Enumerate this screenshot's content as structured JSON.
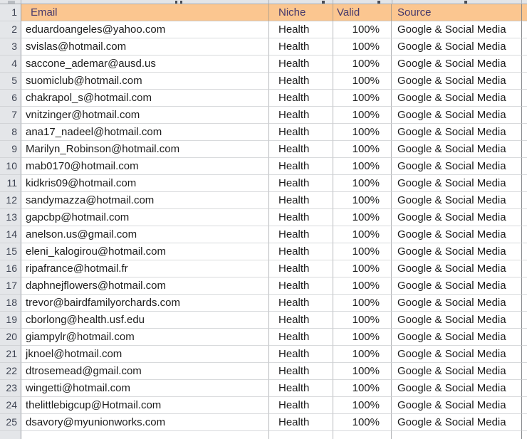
{
  "spreadsheet": {
    "header": {
      "row_number": "1",
      "email": "Email",
      "niche": "Niche",
      "valid": "Valid",
      "source": "Source"
    },
    "rows": [
      {
        "n": "2",
        "email": "eduardoangeles@yahoo.com",
        "niche": "Health",
        "valid": "100%",
        "source": "Google & Social Media"
      },
      {
        "n": "3",
        "email": "svislas@hotmail.com",
        "niche": "Health",
        "valid": "100%",
        "source": "Google & Social Media"
      },
      {
        "n": "4",
        "email": "saccone_ademar@ausd.us",
        "niche": "Health",
        "valid": "100%",
        "source": "Google & Social Media"
      },
      {
        "n": "5",
        "email": "suomiclub@hotmail.com",
        "niche": "Health",
        "valid": "100%",
        "source": "Google & Social Media"
      },
      {
        "n": "6",
        "email": "chakrapol_s@hotmail.com",
        "niche": "Health",
        "valid": "100%",
        "source": "Google & Social Media"
      },
      {
        "n": "7",
        "email": "vnitzinger@hotmail.com",
        "niche": "Health",
        "valid": "100%",
        "source": "Google & Social Media"
      },
      {
        "n": "8",
        "email": "ana17_nadeel@hotmail.com",
        "niche": "Health",
        "valid": "100%",
        "source": "Google & Social Media"
      },
      {
        "n": "9",
        "email": "Marilyn_Robinson@hotmail.com",
        "niche": "Health",
        "valid": "100%",
        "source": "Google & Social Media"
      },
      {
        "n": "10",
        "email": "mab0170@hotmail.com",
        "niche": "Health",
        "valid": "100%",
        "source": "Google & Social Media"
      },
      {
        "n": "11",
        "email": "kidkris09@hotmail.com",
        "niche": "Health",
        "valid": "100%",
        "source": "Google & Social Media"
      },
      {
        "n": "12",
        "email": "sandymazza@hotmail.com",
        "niche": "Health",
        "valid": "100%",
        "source": "Google & Social Media"
      },
      {
        "n": "13",
        "email": "gapcbp@hotmail.com",
        "niche": "Health",
        "valid": "100%",
        "source": "Google & Social Media"
      },
      {
        "n": "14",
        "email": "anelson.us@gmail.com",
        "niche": "Health",
        "valid": "100%",
        "source": "Google & Social Media"
      },
      {
        "n": "15",
        "email": "eleni_kalogirou@hotmail.com",
        "niche": "Health",
        "valid": "100%",
        "source": "Google & Social Media"
      },
      {
        "n": "16",
        "email": "ripafrance@hotmail.fr",
        "niche": "Health",
        "valid": "100%",
        "source": "Google & Social Media"
      },
      {
        "n": "17",
        "email": "daphnejflowers@hotmail.com",
        "niche": "Health",
        "valid": "100%",
        "source": "Google & Social Media"
      },
      {
        "n": "18",
        "email": "trevor@bairdfamilyorchards.com",
        "niche": "Health",
        "valid": "100%",
        "source": "Google & Social Media"
      },
      {
        "n": "19",
        "email": "cborlong@health.usf.edu",
        "niche": "Health",
        "valid": "100%",
        "source": "Google & Social Media"
      },
      {
        "n": "20",
        "email": "giampylr@hotmail.com",
        "niche": "Health",
        "valid": "100%",
        "source": "Google & Social Media"
      },
      {
        "n": "21",
        "email": "jknoel@hotmail.com",
        "niche": "Health",
        "valid": "100%",
        "source": "Google & Social Media"
      },
      {
        "n": "22",
        "email": "dtrosemead@gmail.com",
        "niche": "Health",
        "valid": "100%",
        "source": "Google & Social Media"
      },
      {
        "n": "23",
        "email": "wingetti@hotmail.com",
        "niche": "Health",
        "valid": "100%",
        "source": "Google & Social Media"
      },
      {
        "n": "24",
        "email": "thelittlebigcup@Hotmail.com",
        "niche": "Health",
        "valid": "100%",
        "source": "Google & Social Media"
      },
      {
        "n": "25",
        "email": "dsavory@myunionworks.com",
        "niche": "Health",
        "valid": "100%",
        "source": "Google & Social Media"
      }
    ]
  },
  "colors": {
    "header_bg": "#FBC690",
    "header_text": "#47396B",
    "gutter_bg": "#E4E6E9",
    "gutter_text": "#3E4453",
    "body_text": "#1D1D1D",
    "gridline_horizontal": "#D8DADC",
    "gridline_vertical": "#B6B8BB",
    "table_right_border": "#85878A"
  }
}
